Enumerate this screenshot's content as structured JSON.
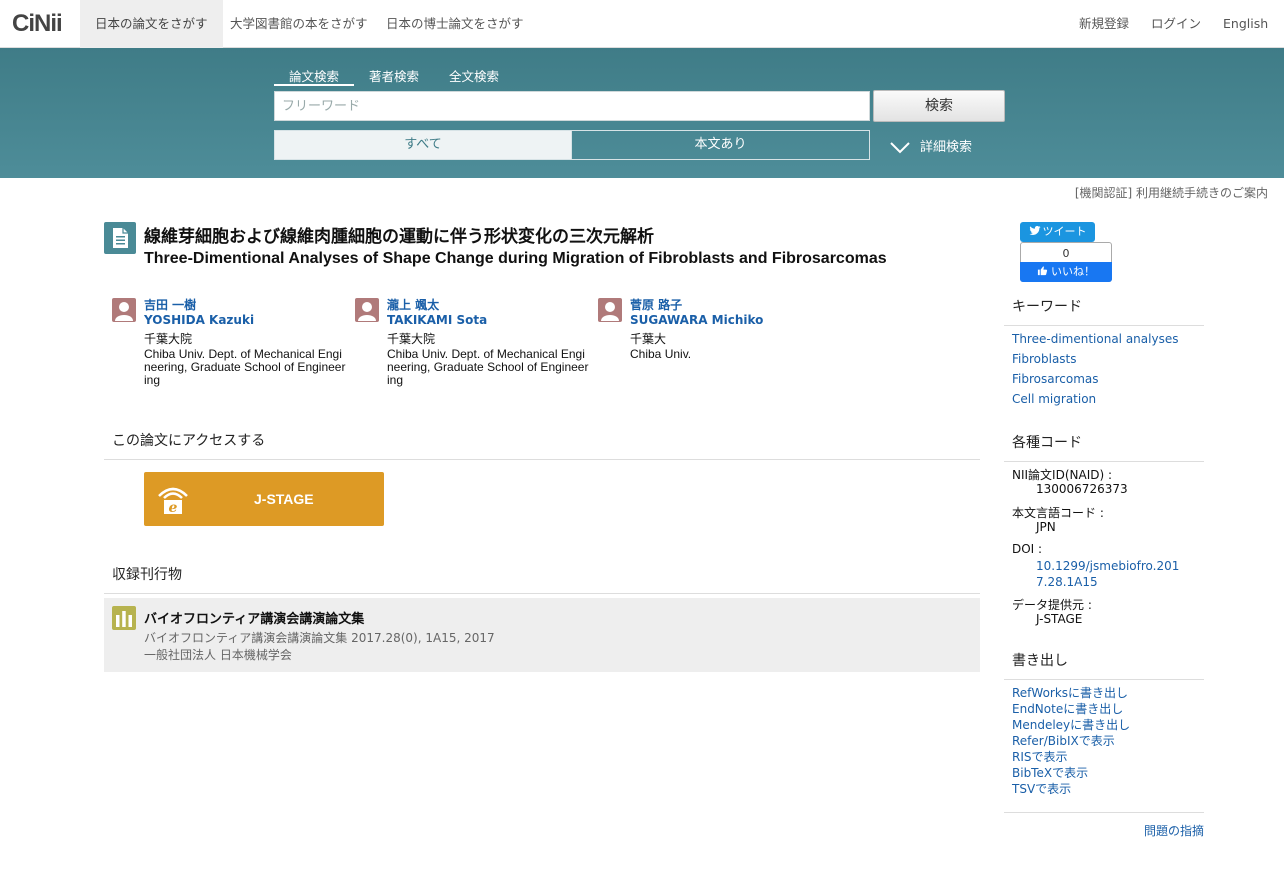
{
  "nav": {
    "logo": "CiNii",
    "tabs": [
      "日本の論文をさがす",
      "大学図書館の本をさがす",
      "日本の博士論文をさがす"
    ],
    "register": "新規登録",
    "login": "ログイン",
    "language": "English"
  },
  "search": {
    "tabs": [
      "論文検索",
      "著者検索",
      "全文検索"
    ],
    "placeholder": "フリーワード",
    "button": "検索",
    "filter_all": "すべて",
    "filter_fulltext": "本文あり",
    "advanced": "詳細検索"
  },
  "notice": "[機関認証] 利用継続手続きのご案内",
  "article": {
    "title_ja": "線維芽細胞および線維肉腫細胞の運動に伴う形状変化の三次元解析",
    "title_en": "Three-Dimentional Analyses of Shape Change during Migration of Fibroblasts and Fibrosarcomas",
    "authors": [
      {
        "name_ja": "吉田 一樹",
        "name_en": "YOSHIDA Kazuki",
        "affil_ja": "千葉大院",
        "affil_en": "Chiba Univ. Dept. of Mechanical Engineering, Graduate School of Engineering"
      },
      {
        "name_ja": "瀧上 颯太",
        "name_en": "TAKIKAMI Sota",
        "affil_ja": "千葉大院",
        "affil_en": "Chiba Univ. Dept. of Mechanical Engineering, Graduate School of Engineering"
      },
      {
        "name_ja": "菅原 路子",
        "name_en": "SUGAWARA Michiko",
        "affil_ja": "千葉大",
        "affil_en": "Chiba Univ."
      }
    ]
  },
  "access": {
    "heading": "この論文にアクセスする",
    "jstage_label": "J-STAGE"
  },
  "journal": {
    "heading": "収録刊行物",
    "title": "バイオフロンティア講演会講演論文集",
    "meta": "バイオフロンティア講演会講演論文集 2017.28(0), 1A15, 2017",
    "publisher": "一般社団法人 日本機械学会"
  },
  "social": {
    "tweet": "ツイート",
    "like_count": "0",
    "like": "いいね！"
  },
  "keywords": {
    "heading": "キーワード",
    "items": [
      "Three-dimentional analyses",
      "Fibroblasts",
      "Fibrosarcomas",
      "Cell migration"
    ]
  },
  "codes": {
    "heading": "各種コード",
    "naid_label": "NII論文ID(NAID) :",
    "naid": "130006726373",
    "lang_label": "本文言語コード :",
    "lang": "JPN",
    "doi_label": "DOI :",
    "doi": "10.1299/jsmebiofro.2017.28.1A15",
    "provider_label": "データ提供元 :",
    "provider": "J-STAGE"
  },
  "export": {
    "heading": "書き出し",
    "items": [
      "RefWorksに書き出し",
      "EndNoteに書き出し",
      "Mendeleyに書き出し",
      "Refer/BibIXで表示",
      "RISで表示",
      "BibTeXで表示",
      "TSVで表示"
    ]
  },
  "report": "問題の指摘",
  "colors": {
    "band": "#4a8a96",
    "link": "#1a5fa8",
    "jstage": "#dd9a25",
    "journal_icon": "#b7b34f",
    "author_icon": "#b07a7a"
  }
}
